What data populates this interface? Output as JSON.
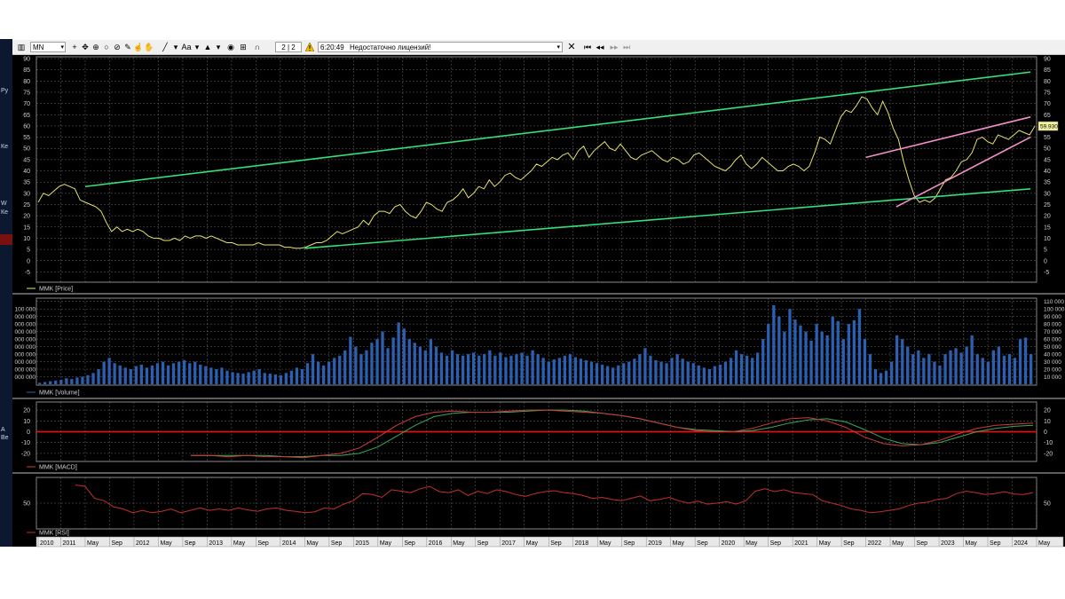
{
  "toolbar": {
    "symbol_period": "MN",
    "page_indicator": "2 | 2",
    "time": "6:20:49",
    "status_message": "Недостаточно лицензий!",
    "icons": [
      "bar-chart-icon",
      "crosshair-icon",
      "move-icon",
      "target-icon",
      "circle-icon",
      "ruler-icon",
      "hand-icon",
      "pan-icon",
      "line-tool-icon",
      "text-tool-icon",
      "fill-icon",
      "view-icon",
      "grid-icon",
      "magnet-icon"
    ],
    "right_icons": [
      "close-icon",
      "first-icon",
      "prev-icon",
      "next-icon",
      "last-icon"
    ]
  },
  "left_strip": {
    "texts": [
      "Ру",
      "Ке",
      "W",
      "Ке",
      "А",
      "Be"
    ]
  },
  "colors": {
    "background": "#000000",
    "price": "#e8e36a",
    "trend_green": "#33e07a",
    "trend_pink": "#f090c8",
    "volume": "#2b5fb0",
    "macd": "#d23a3a",
    "signal": "#3aa85a",
    "zero_line": "#e01010",
    "rsi": "#c23030",
    "grid": "#6a6a6a"
  },
  "panels": {
    "price": {
      "legend": "MMK [Price]",
      "last_value": "59.930"
    },
    "volume": {
      "legend": "MMK [Volume]"
    },
    "macd": {
      "legend": "MMK [MACD]"
    },
    "rsi": {
      "legend": "MMK [RSI]"
    }
  },
  "chart_data": [
    {
      "type": "line",
      "title": "",
      "series_name": "MMK [Price]",
      "ylim": [
        -8,
        90
      ],
      "yticks": [
        -5,
        0,
        5,
        10,
        15,
        20,
        25,
        30,
        35,
        40,
        45,
        50,
        55,
        60,
        65,
        70,
        75,
        80,
        85,
        90
      ],
      "last_value": 59.93,
      "x_start": "2010-09",
      "x_end": "2024-04",
      "values": [
        26,
        30,
        29,
        31,
        33,
        34,
        33,
        32,
        27,
        26,
        25,
        24,
        22,
        17,
        13,
        15,
        13,
        14,
        13,
        14,
        13,
        11,
        10,
        10,
        9,
        9,
        10,
        9,
        11,
        10,
        11,
        11,
        10,
        11,
        10,
        9,
        8,
        8,
        7,
        7,
        7,
        7,
        8,
        7,
        7,
        7,
        7,
        6,
        6,
        5.5,
        5.5,
        6,
        7,
        8,
        8,
        9,
        11,
        13,
        12,
        13,
        14,
        15,
        18,
        16,
        20,
        22,
        22,
        21,
        24,
        25,
        22,
        20,
        19,
        22,
        26,
        25,
        23,
        22,
        26,
        27,
        29,
        32,
        28,
        30,
        33,
        32,
        36,
        33,
        35,
        38,
        39,
        37,
        36,
        38,
        40,
        43,
        42,
        44,
        46,
        45,
        47,
        48,
        45,
        49,
        51,
        46,
        49,
        51,
        53,
        50,
        49,
        52,
        49,
        46,
        45,
        47,
        48,
        49,
        47,
        45,
        44,
        46,
        45,
        43,
        44,
        47,
        48,
        46,
        44,
        42,
        41,
        40,
        42,
        45,
        47,
        43,
        41,
        43,
        46,
        44,
        42,
        40,
        40,
        42,
        43,
        42,
        40,
        42,
        48,
        55,
        54,
        52,
        58,
        64,
        67,
        66,
        69,
        73,
        72,
        68,
        65,
        71,
        66,
        59,
        54,
        44,
        36,
        29,
        26,
        27,
        26,
        28,
        32,
        36,
        37,
        40,
        44,
        45,
        48,
        54,
        55,
        53,
        52,
        56,
        55,
        54,
        56,
        58,
        57,
        56,
        59.93
      ],
      "trendlines": [
        {
          "color": "green",
          "from": [
            "2011-05",
            33
          ],
          "to": [
            "2024-04",
            84
          ]
        },
        {
          "color": "green",
          "from": [
            "2014-05",
            5.5
          ],
          "to": [
            "2024-04",
            32
          ]
        },
        {
          "color": "pink",
          "from": [
            "2022-01",
            46
          ],
          "to": [
            "2024-04",
            64
          ]
        },
        {
          "color": "pink",
          "from": [
            "2022-06",
            24
          ],
          "to": [
            "2024-04",
            55
          ]
        }
      ]
    },
    {
      "type": "bar",
      "title": "",
      "series_name": "MMK [Volume]",
      "ylim": [
        0,
        112000
      ],
      "yticks_right": [
        10000,
        20000,
        30000,
        40000,
        50000,
        60000,
        70000,
        80000,
        90000,
        100000,
        110000
      ],
      "yticks_right_labels": [
        "10 000",
        "20 000",
        "30 000",
        "40 000",
        "50 000",
        "60 000",
        "70 000",
        "80 000",
        "90 000",
        "100 000",
        "110 000"
      ],
      "yticks_left_labels": [
        "000 000",
        "000 000",
        "000 000",
        "000 000",
        "000 000",
        "000 000",
        "000 000",
        "000 000",
        "000 000",
        "100 000"
      ],
      "values": [
        2000,
        3000,
        4000,
        5000,
        6000,
        8000,
        7000,
        9000,
        10000,
        12000,
        15000,
        20000,
        30000,
        35000,
        28000,
        25000,
        22000,
        20000,
        24000,
        26000,
        22000,
        25000,
        28000,
        30000,
        25000,
        28000,
        30000,
        32000,
        28000,
        30000,
        26000,
        24000,
        22000,
        20000,
        22000,
        18000,
        16000,
        15000,
        14000,
        16000,
        18000,
        20000,
        15000,
        14000,
        13000,
        12000,
        15000,
        18000,
        22000,
        20000,
        28000,
        40000,
        30000,
        25000,
        30000,
        35000,
        38000,
        45000,
        63000,
        50000,
        40000,
        45000,
        55000,
        60000,
        70000,
        48000,
        62000,
        82000,
        74000,
        60000,
        55000,
        50000,
        45000,
        60000,
        50000,
        42000,
        38000,
        45000,
        40000,
        38000,
        40000,
        42000,
        38000,
        40000,
        45000,
        38000,
        42000,
        36000,
        38000,
        40000,
        42000,
        38000,
        45000,
        40000,
        35000,
        30000,
        33000,
        35000,
        38000,
        40000,
        36000,
        34000,
        32000,
        30000,
        28000,
        26000,
        24000,
        22000,
        25000,
        28000,
        30000,
        34000,
        40000,
        48000,
        38000,
        32000,
        30000,
        28000,
        35000,
        40000,
        34000,
        30000,
        28000,
        25000,
        22000,
        20000,
        24000,
        26000,
        30000,
        35000,
        45000,
        40000,
        38000,
        35000,
        42000,
        60000,
        80000,
        105000,
        90000,
        70000,
        100000,
        86000,
        78000,
        70000,
        58000,
        80000,
        70000,
        65000,
        90000,
        84000,
        60000,
        80000,
        85000,
        100000,
        60000,
        40000,
        20000,
        15000,
        18000,
        30000,
        65000,
        60000,
        50000,
        40000,
        45000,
        35000,
        40000,
        30000,
        25000,
        40000,
        45000,
        48000,
        42000,
        50000,
        65000,
        40000,
        35000,
        30000,
        45000,
        50000,
        38000,
        40000,
        35000,
        60000,
        62000,
        40000
      ],
      "color": "#2b5fb0"
    },
    {
      "type": "line",
      "title": "",
      "series_name": "MMK [MACD]",
      "ylim": [
        -25,
        25
      ],
      "yticks": [
        -20,
        -10,
        0,
        10,
        20
      ],
      "series": [
        {
          "name": "MACD",
          "values": [
            -22,
            -22,
            -23,
            -22,
            -23,
            -23,
            -24,
            -22,
            -20,
            -15,
            -5,
            6,
            14,
            18,
            19,
            18,
            18,
            19,
            20,
            20,
            19,
            18,
            17,
            15,
            12,
            8,
            4,
            1,
            0,
            0,
            3,
            8,
            12,
            13,
            10,
            4,
            -5,
            -11,
            -13,
            -12,
            -8,
            -2,
            3,
            6,
            7,
            8
          ]
        },
        {
          "name": "Signal",
          "values": [
            -22,
            -22,
            -22,
            -22,
            -22,
            -23,
            -23,
            -22,
            -22,
            -20,
            -14,
            -4,
            6,
            14,
            17,
            18,
            18,
            18,
            19,
            20,
            20,
            19,
            17,
            15,
            12,
            8,
            4,
            2,
            1,
            0,
            1,
            4,
            8,
            11,
            12,
            9,
            2,
            -6,
            -11,
            -12,
            -10,
            -5,
            0,
            3,
            5,
            6
          ]
        }
      ],
      "zero_line": 0
    },
    {
      "type": "line",
      "title": "",
      "series_name": "MMK [RSI]",
      "ylim": [
        0,
        100
      ],
      "yticks": [
        50
      ],
      "values": [
        88,
        85,
        60,
        55,
        42,
        38,
        30,
        35,
        30,
        33,
        38,
        30,
        35,
        40,
        35,
        38,
        35,
        40,
        36,
        33,
        38,
        40,
        35,
        33,
        30,
        32,
        40,
        38,
        48,
        55,
        70,
        68,
        62,
        78,
        75,
        72,
        80,
        85,
        74,
        72,
        78,
        66,
        75,
        70,
        78,
        74,
        68,
        64,
        70,
        74,
        76,
        72,
        70,
        66,
        60,
        62,
        58,
        55,
        60,
        65,
        55,
        58,
        62,
        55,
        50,
        54,
        48,
        50,
        53,
        48,
        55,
        75,
        80,
        74,
        78,
        72,
        70,
        68,
        55,
        50,
        45,
        38,
        35,
        30,
        32,
        35,
        38,
        45,
        50,
        52,
        58,
        60,
        70,
        75,
        72,
        68,
        70,
        74,
        69,
        68,
        72
      ]
    },
    {
      "type": "axis",
      "title": "",
      "x_tick_labels": [
        "2010",
        "2011",
        "May",
        "Sep",
        "2012",
        "May",
        "Sep",
        "2013",
        "May",
        "Sep",
        "2014",
        "May",
        "Sep",
        "2015",
        "May",
        "Sep",
        "2016",
        "May",
        "Sep",
        "2017",
        "May",
        "Sep",
        "2018",
        "May",
        "Sep",
        "2019",
        "May",
        "Sep",
        "2020",
        "May",
        "Sep",
        "2021",
        "May",
        "Sep",
        "2022",
        "May",
        "Sep",
        "2023",
        "May",
        "Sep",
        "2024",
        "May"
      ]
    }
  ]
}
